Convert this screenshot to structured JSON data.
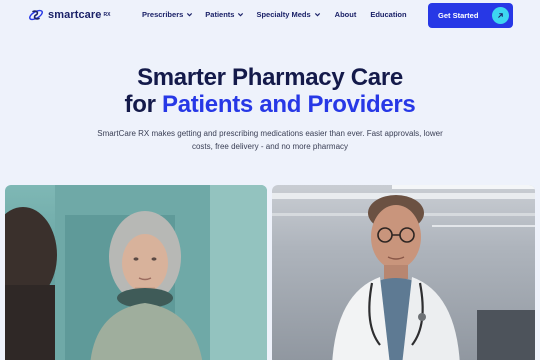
{
  "brand": {
    "name": "smartcare",
    "tm": "RX",
    "colors": {
      "navy": "#141a4a",
      "blue": "#2738e6",
      "cyan": "#3dd6f0",
      "bg": "#eef2fb"
    }
  },
  "nav": {
    "items": [
      {
        "label": "Prescribers",
        "has_dropdown": true
      },
      {
        "label": "Patients",
        "has_dropdown": true
      },
      {
        "label": "Specialty Meds",
        "has_dropdown": true
      },
      {
        "label": "About",
        "has_dropdown": false
      },
      {
        "label": "Education",
        "has_dropdown": false
      }
    ],
    "cta": {
      "label": "Get Started",
      "icon": "arrow-up-right-icon"
    }
  },
  "hero": {
    "title_line1": "Smarter Pharmacy Care",
    "title_line2_prefix": "for ",
    "title_line2_accent": "Patients and Providers",
    "subtitle": "SmartCare RX makes getting and prescribing medications easier than ever. Fast approvals, lower costs, free delivery - and no more pharmacy"
  },
  "images": [
    {
      "subject": "patient-photo",
      "icon": "photo-icon"
    },
    {
      "subject": "doctor-photo",
      "icon": "photo-icon"
    }
  ]
}
